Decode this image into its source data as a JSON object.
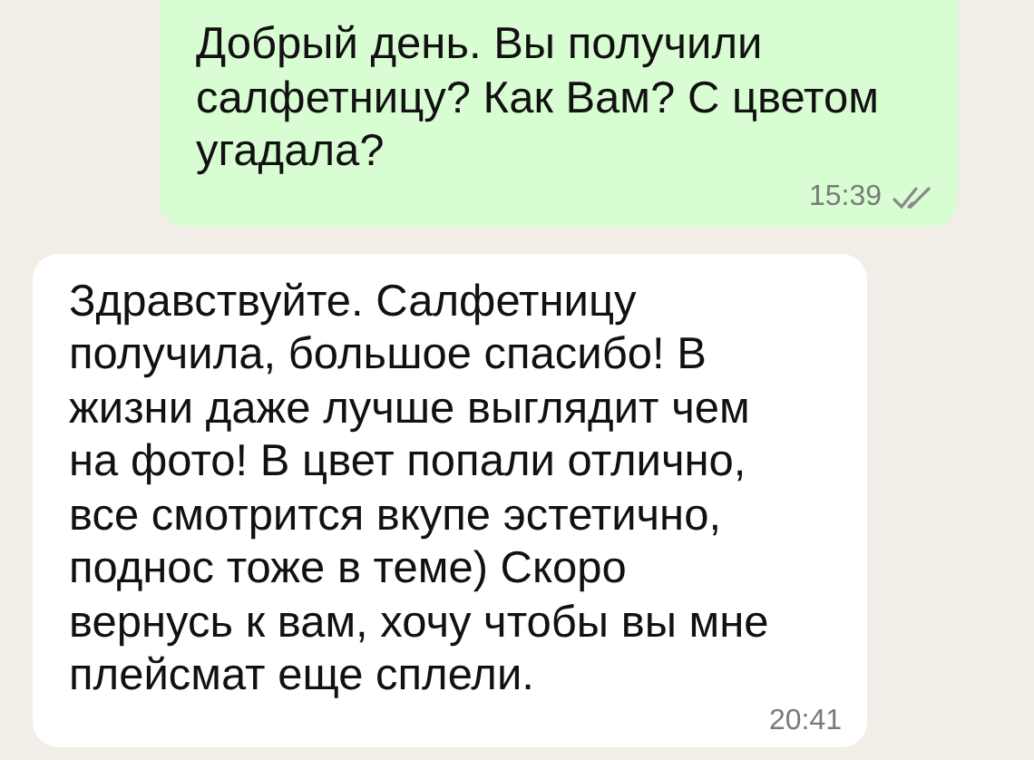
{
  "messages": [
    {
      "kind": "outgoing",
      "text": "Добрый день. Вы получили\nсалфетницу? Как Вам? С цветом\nугадала?",
      "time": "15:39",
      "read": false
    },
    {
      "kind": "incoming",
      "text": "Здравствуйте. Салфетницу\nполучила, большое спасибо! В\nжизни даже лучше выглядит чем\nна фото! В цвет попали отлично,\nвсе смотрится вкупе эстетично,\nподнос тоже в теме) Скоро\nвернусь к вам, хочу чтобы вы мне\nплейсмат еще сплели.",
      "time": "20:41"
    }
  ]
}
